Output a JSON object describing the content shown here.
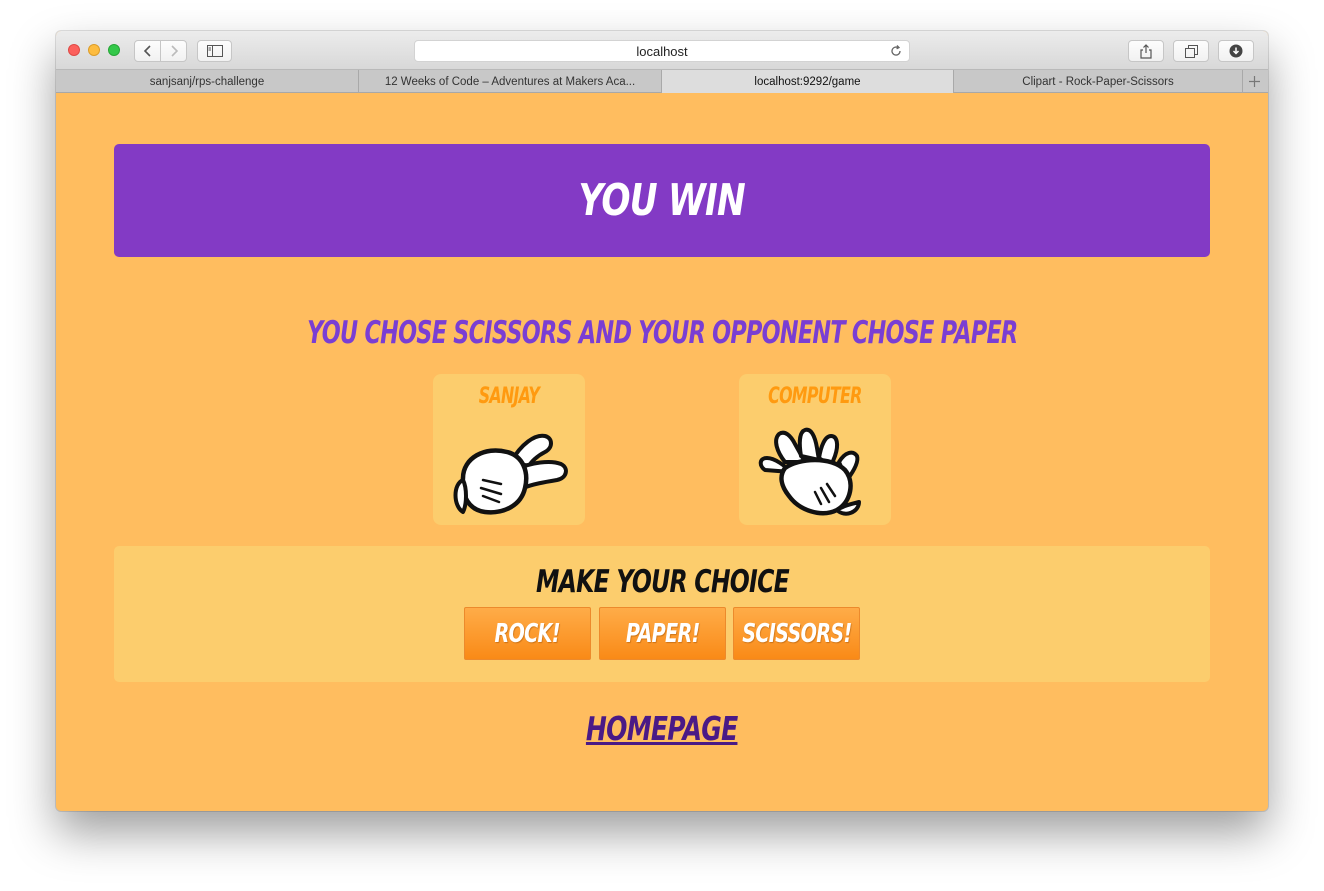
{
  "browser": {
    "address": "localhost",
    "tabs": [
      {
        "label": "sanjsanj/rps-challenge",
        "active": false
      },
      {
        "label": "12 Weeks of Code – Adventures at Makers Aca...",
        "active": false
      },
      {
        "label": "localhost:9292/game",
        "active": true
      },
      {
        "label": "Clipart - Rock-Paper-Scissors",
        "active": false
      }
    ]
  },
  "game": {
    "result": "You win",
    "summary": "You chose Scissors and your opponent chose Paper",
    "player1": {
      "name": "Sanjay",
      "choice": "scissors",
      "icon": "scissors-hand-icon"
    },
    "player2": {
      "name": "Computer",
      "choice": "paper",
      "icon": "paper-hand-icon"
    },
    "choice_title": "Make your choice",
    "buttons": {
      "rock": "Rock!",
      "paper": "Paper!",
      "scissors": "Scissors!"
    },
    "homepage_link": "Homepage"
  },
  "colors": {
    "page_bg": "#ffbd5f",
    "banner": "#833ac5",
    "summary_text": "#7a3ed3",
    "card_bg": "#fccd6d",
    "player_name": "#ff9a10",
    "button": "#f98a17",
    "link": "#4a1a86"
  }
}
